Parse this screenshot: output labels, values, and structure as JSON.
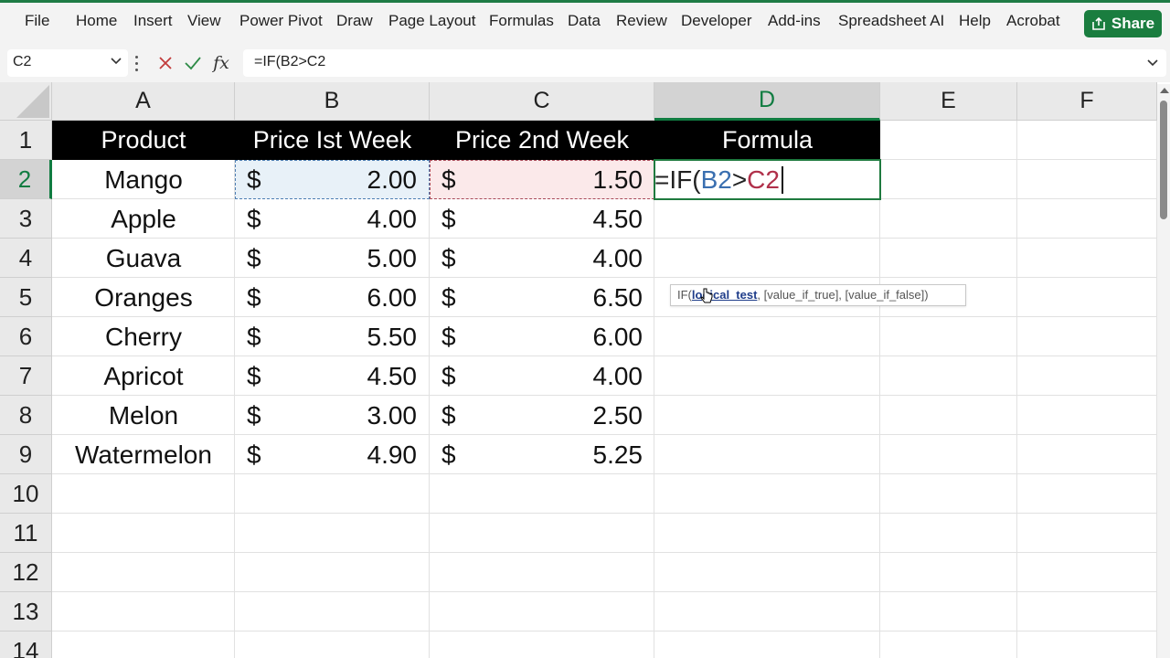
{
  "ribbon": {
    "tabs": [
      "File",
      "Home",
      "Insert",
      "View",
      "Power Pivot",
      "Draw",
      "Page Layout",
      "Formulas",
      "Data",
      "Review",
      "Developer",
      "Add-ins",
      "Spreadsheet AI",
      "Help",
      "Acrobat"
    ],
    "share_label": "Share",
    "share_icon": "share-icon",
    "accent_color": "#1e7b45"
  },
  "formula_bar": {
    "name_box": "C2",
    "formula": "=IF(B2>C2",
    "fx_label": "fx",
    "cancel_icon": "close-icon",
    "enter_icon": "check-icon"
  },
  "sheet": {
    "columns": [
      "A",
      "B",
      "C",
      "D",
      "E",
      "F"
    ],
    "active_column": "D",
    "rows": [
      "1",
      "2",
      "3",
      "4",
      "5",
      "6",
      "7",
      "8",
      "9",
      "10",
      "11",
      "12",
      "13",
      "14"
    ],
    "active_row": "2",
    "headers": [
      "Product",
      "Price Ist Week",
      "Price 2nd Week",
      "Formula"
    ],
    "data": [
      {
        "product": "Mango",
        "week1": "2.00",
        "week2": "1.50"
      },
      {
        "product": "Apple",
        "week1": "4.00",
        "week2": "4.50"
      },
      {
        "product": "Guava",
        "week1": "5.00",
        "week2": "4.00"
      },
      {
        "product": "Oranges",
        "week1": "6.00",
        "week2": "6.50"
      },
      {
        "product": "Cherry",
        "week1": "5.50",
        "week2": "6.00"
      },
      {
        "product": "Apricot",
        "week1": "4.50",
        "week2": "4.00"
      },
      {
        "product": "Melon",
        "week1": "3.00",
        "week2": "2.50"
      },
      {
        "product": "Watermelon",
        "week1": "4.90",
        "week2": "5.25"
      }
    ],
    "currency_symbol": "$",
    "edit_cell": {
      "prefix": "=IF(",
      "ref1": "B2",
      "op": ">",
      "ref2": "C2"
    },
    "tooltip": {
      "func": "IF(",
      "arg1": "logical_test",
      "rest": ", [value_if_true], [value_if_false])"
    }
  }
}
